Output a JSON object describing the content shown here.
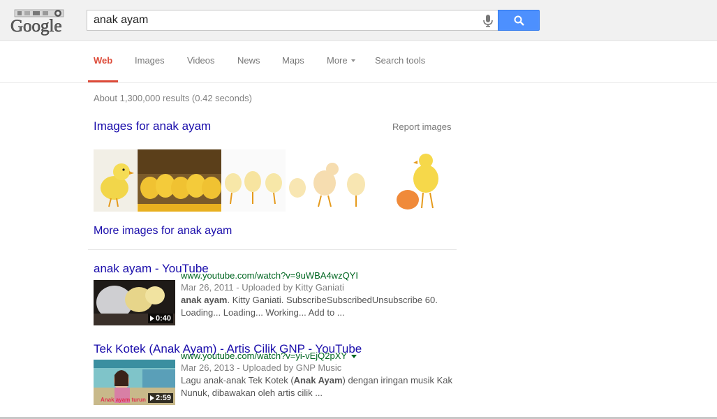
{
  "search": {
    "query": "anak ayam",
    "button_label": "Search"
  },
  "logo": {
    "text": "Google"
  },
  "tabs": [
    {
      "label": "Web",
      "active": true
    },
    {
      "label": "Images"
    },
    {
      "label": "Videos"
    },
    {
      "label": "News"
    },
    {
      "label": "Maps"
    },
    {
      "label": "More"
    },
    {
      "label": "Search tools"
    }
  ],
  "stats": "About 1,300,000 results (0.42 seconds)",
  "images_block": {
    "header": "Images for anak ayam",
    "report": "Report images",
    "more_link": "More images for anak ayam"
  },
  "results": [
    {
      "title": "anak ayam - YouTube",
      "url": "www.youtube.com/watch?v=9uWBA4wzQYI",
      "meta": "Mar 26, 2011 - Uploaded by Kitty Ganiati",
      "snippet_bold": "anak ayam",
      "snippet_rest": ". Kitty Ganiati. SubscribeSubscribedUnsubscribe 60. Loading... Loading... Working... Add to ...",
      "duration": "0:40"
    },
    {
      "title": "Tek Kotek (Anak Ayam) - Artis Cilik GNP - YouTube",
      "url": "www.youtube.com/watch?v=yi-vEjQ2pXY",
      "meta": "Mar 26, 2013 - Uploaded by GNP Music",
      "snippet_pre": "Lagu anak-anak Tek Kotek (",
      "snippet_bold": "Anak Ayam",
      "snippet_post": ") dengan iringan musik Kak Nunuk, dibawakan oleh artis cilik ...",
      "duration": "2:59",
      "thumb_caption": "Anak ayam turun"
    }
  ],
  "colors": {
    "link": "#1a0dab",
    "url": "#006621",
    "active_tab": "#dd4b39",
    "search_button": "#4d90fe"
  }
}
